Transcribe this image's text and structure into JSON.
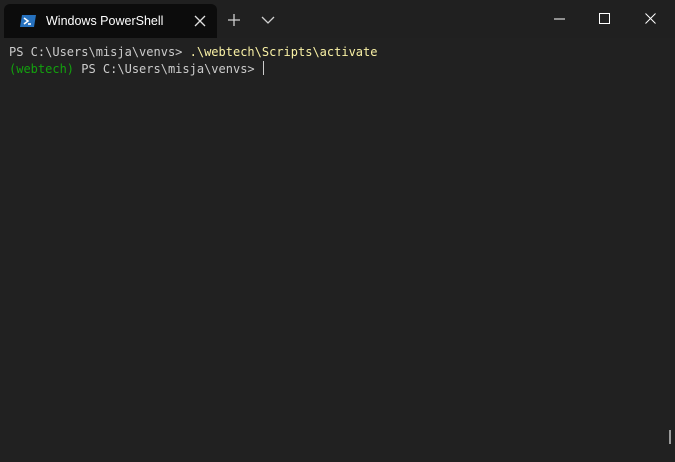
{
  "tab": {
    "title": "Windows PowerShell",
    "icon": "powershell-icon"
  },
  "terminal": {
    "line1_prompt": "PS C:\\Users\\misja\\venvs> ",
    "line1_command": ".\\webtech\\Scripts\\activate",
    "line2_venv": "(webtech)",
    "line2_prompt": " PS C:\\Users\\misja\\venvs> "
  },
  "colors": {
    "titlebar": "#202020",
    "terminal_bg": "#212121",
    "command": "#f9f1a5",
    "venv": "#13a10e",
    "powershell_blue": "#2671be"
  }
}
